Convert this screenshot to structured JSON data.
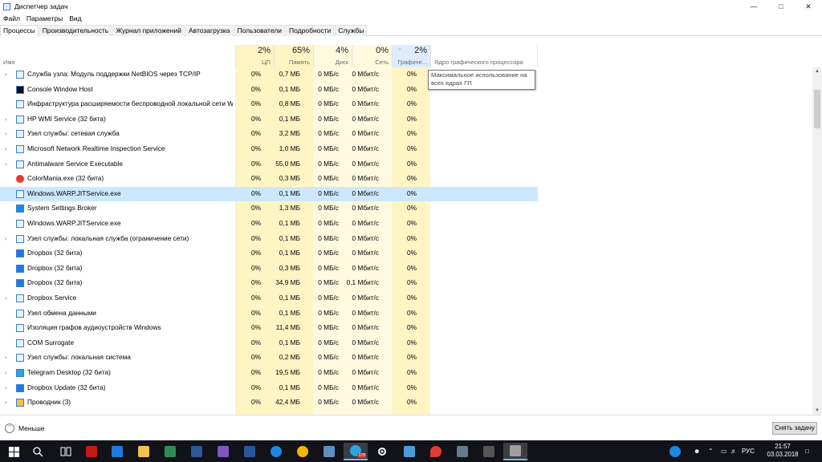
{
  "window": {
    "title": "Диспетчер задач"
  },
  "menu": [
    "Файл",
    "Параметры",
    "Вид"
  ],
  "tabs": [
    {
      "label": "Процессы",
      "active": true
    },
    {
      "label": "Производительность",
      "active": false
    },
    {
      "label": "Журнал приложений",
      "active": false
    },
    {
      "label": "Автозагрузка",
      "active": false
    },
    {
      "label": "Пользователи",
      "active": false
    },
    {
      "label": "Подробности",
      "active": false
    },
    {
      "label": "Службы",
      "active": false
    }
  ],
  "columns": {
    "name": "Имя",
    "cpu": {
      "pct": "2%",
      "label": "ЦП"
    },
    "mem": {
      "pct": "65%",
      "label": "Память"
    },
    "disk": {
      "pct": "4%",
      "label": "Диск"
    },
    "net": {
      "pct": "0%",
      "label": "Сеть"
    },
    "gpu": {
      "pct": "2%",
      "label": "Графиче..."
    },
    "gpu_engine": {
      "label": "Ядро графического процессора"
    }
  },
  "tooltip": "Максимальное использование на всех ядрах ГП",
  "rows": [
    {
      "name": "Служба узла: Модуль поддержки NetBIOS через TCP/IP",
      "expand": true,
      "cpu": "0%",
      "mem": "0,7 МБ",
      "disk": "0 МБ/с",
      "net": "0 Мбит/с",
      "gpu": "0%",
      "icon": "service-host-icon"
    },
    {
      "name": "Console Window Host",
      "expand": false,
      "cpu": "0%",
      "mem": "0,1 МБ",
      "disk": "0 МБ/с",
      "net": "0 Мбит/с",
      "gpu": "0%",
      "icon": "console-icon"
    },
    {
      "name": "Инфраструктура расширяемости беспроводной локальной сети W...",
      "expand": false,
      "cpu": "0%",
      "mem": "0,8 МБ",
      "disk": "0 МБ/с",
      "net": "0 Мбит/с",
      "gpu": "0%",
      "icon": "app-icon"
    },
    {
      "name": "HP WMI Service (32 бита)",
      "expand": true,
      "cpu": "0%",
      "mem": "0,1 МБ",
      "disk": "0 МБ/с",
      "net": "0 Мбит/с",
      "gpu": "0%",
      "icon": "app-icon"
    },
    {
      "name": "Узел службы: сетевая служба",
      "expand": true,
      "cpu": "0%",
      "mem": "3,2 МБ",
      "disk": "0 МБ/с",
      "net": "0 Мбит/с",
      "gpu": "0%",
      "icon": "service-host-icon"
    },
    {
      "name": "Microsoft Network Realtime Inspection Service",
      "expand": true,
      "cpu": "0%",
      "mem": "1,0 МБ",
      "disk": "0 МБ/с",
      "net": "0 Мбит/с",
      "gpu": "0%",
      "icon": "app-icon"
    },
    {
      "name": "Antimalware Service Executable",
      "expand": true,
      "cpu": "0%",
      "mem": "55,0 МБ",
      "disk": "0 МБ/с",
      "net": "0 Мбит/с",
      "gpu": "0%",
      "icon": "app-icon"
    },
    {
      "name": "ColorMania.exe (32 бита)",
      "expand": false,
      "cpu": "0%",
      "mem": "0,3 МБ",
      "disk": "0 МБ/с",
      "net": "0 Мбит/с",
      "gpu": "0%",
      "icon": "colormania-icon"
    },
    {
      "name": "Windows.WARP.JITService.exe",
      "expand": false,
      "cpu": "0%",
      "mem": "0,1 МБ",
      "disk": "0 МБ/с",
      "net": "0 Мбит/с",
      "gpu": "0%",
      "icon": "app-icon",
      "selected": true
    },
    {
      "name": "System Settings Broker",
      "expand": false,
      "cpu": "0%",
      "mem": "1,3 МБ",
      "disk": "0 МБ/с",
      "net": "0 Мбит/с",
      "gpu": "0%",
      "icon": "settings-icon"
    },
    {
      "name": "Windows.WARP.JITService.exe",
      "expand": false,
      "cpu": "0%",
      "mem": "0,1 МБ",
      "disk": "0 МБ/с",
      "net": "0 Мбит/с",
      "gpu": "0%",
      "icon": "app-icon"
    },
    {
      "name": "Узел службы: локальная служба (ограничение сети)",
      "expand": true,
      "cpu": "0%",
      "mem": "0,1 МБ",
      "disk": "0 МБ/с",
      "net": "0 Мбит/с",
      "gpu": "0%",
      "icon": "service-host-icon"
    },
    {
      "name": "Dropbox (32 бита)",
      "expand": false,
      "cpu": "0%",
      "mem": "0,1 МБ",
      "disk": "0 МБ/с",
      "net": "0 Мбит/с",
      "gpu": "0%",
      "icon": "dropbox-icon"
    },
    {
      "name": "Dropbox (32 бита)",
      "expand": false,
      "cpu": "0%",
      "mem": "0,3 МБ",
      "disk": "0 МБ/с",
      "net": "0 Мбит/с",
      "gpu": "0%",
      "icon": "dropbox-icon"
    },
    {
      "name": "Dropbox (32 бита)",
      "expand": false,
      "cpu": "0%",
      "mem": "34,9 МБ",
      "disk": "0 МБ/с",
      "net": "0,1 Мбит/с",
      "gpu": "0%",
      "icon": "dropbox-icon"
    },
    {
      "name": "Dropbox Service",
      "expand": true,
      "cpu": "0%",
      "mem": "0,1 МБ",
      "disk": "0 МБ/с",
      "net": "0 Мбит/с",
      "gpu": "0%",
      "icon": "app-icon"
    },
    {
      "name": "Узел обмена данными",
      "expand": false,
      "cpu": "0%",
      "mem": "0,1 МБ",
      "disk": "0 МБ/с",
      "net": "0 Мбит/с",
      "gpu": "0%",
      "icon": "app-icon"
    },
    {
      "name": "Изоляция графов аудиоустройств Windows",
      "expand": false,
      "cpu": "0%",
      "mem": "11,4 МБ",
      "disk": "0 МБ/с",
      "net": "0 Мбит/с",
      "gpu": "0%",
      "icon": "app-icon"
    },
    {
      "name": "COM Surrogate",
      "expand": false,
      "cpu": "0%",
      "mem": "0,1 МБ",
      "disk": "0 МБ/с",
      "net": "0 Мбит/с",
      "gpu": "0%",
      "icon": "app-icon"
    },
    {
      "name": "Узел службы: локальная система",
      "expand": true,
      "cpu": "0%",
      "mem": "0,2 МБ",
      "disk": "0 МБ/с",
      "net": "0 Мбит/с",
      "gpu": "0%",
      "icon": "service-host-icon"
    },
    {
      "name": "Telegram Desktop (32 бита)",
      "expand": true,
      "cpu": "0%",
      "mem": "19,5 МБ",
      "disk": "0 МБ/с",
      "net": "0 Мбит/с",
      "gpu": "0%",
      "icon": "telegram-icon"
    },
    {
      "name": "Dropbox Update (32 бита)",
      "expand": true,
      "cpu": "0%",
      "mem": "0,1 МБ",
      "disk": "0 МБ/с",
      "net": "0 Мбит/с",
      "gpu": "0%",
      "icon": "dropbox-icon"
    },
    {
      "name": "Проводник (3)",
      "expand": true,
      "cpu": "0%",
      "mem": "42,4 МБ",
      "disk": "0 МБ/с",
      "net": "0 Мбит/с",
      "gpu": "0%",
      "icon": "explorer-icon"
    }
  ],
  "footer": {
    "fewer": "Меньше",
    "end_task": "Снять задачу"
  },
  "taskbar": {
    "clock_time": "21:57",
    "clock_date": "03.03.2018",
    "lang": "РУС",
    "badge": "178"
  },
  "colors": {
    "selected": "#cce8ff",
    "heat": "#fff4c4",
    "taskbar": "#111318",
    "accent": "#76b9ed"
  }
}
